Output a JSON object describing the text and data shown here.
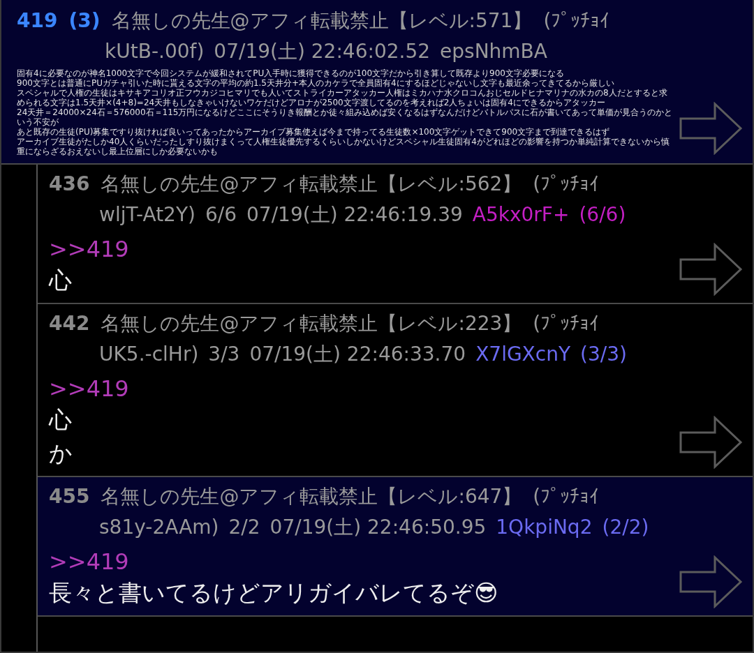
{
  "root_post": {
    "number": "419",
    "reply_count": "(3)",
    "name": "名無しの先生@アフィ転載禁止【レベル:571】",
    "trip": "(ﾌﾟｯﾁｮｲ",
    "id_tail": "kUtB-.00f)",
    "date": "07/19(土) 22:46:02.52",
    "id": "epsNhmBA",
    "highlighted": true,
    "body": [
      "固有4に必要なのが神名1000文字で今回システムが緩和されてPU入手時に獲得できるのが100文字だから引き算して既存より900文字必要になる",
      "900文字とは普通にPUガチャ引いた時に貰える文字の平均の約1.5天井分+本人のカケラで全員固有4にするほどじゃないし文字も最近余ってきてるから厳しい",
      "スペシャルで人権の生徒はキサキアコリオ正フウカジコヒマリでも人いてストライカーアタッカー人権はミカハナ水クロコんおじセルドヒナマリナの水カの8人だとすると求められる文字は1.5天井×(4+8)=24天井もしなきゃいけないワケだけどアロナが2500文字渡してるのを考えれば2人ちょいは固有4にできるからアタッカー",
      "24天井＝24000×24石＝576000石＝115万円になるけどここにそうりき報酬とか徒々組み込めば安くなるはずなんだけどバトルパスに石が書いてあって単価が見合うのかという不安が",
      "あと既存の生徒(PU)募集ですり抜ければ良いってあったからアーカイブ募集使えば今まで持ってる生徒数×100文字ゲットできて900文字まで到達できるはず",
      "アーカイブ生徒がたしか40人くらいだったしすり抜けまくって人権生徒優先するくらいしかないけどスペシャル生徒固有4がどれほどの影響を持つか単純計算できないから慎重にならざるおえないし最上位層にしか必要ないかも"
    ],
    "children": [
      {
        "number": "436",
        "name": "名無しの先生@アフィ転載禁止【レベル:562】",
        "trip": "(ﾌﾟｯﾁｮｲ",
        "id_tail": "wljT-At2Y)",
        "post_count": "6/6",
        "date": "07/19(土) 22:46:19.39",
        "id": "A5kx0rF+",
        "id_count": "(6/6)",
        "color": "#c41fc4",
        "highlighted": false,
        "anchor": ">>419",
        "body": [
          "心"
        ]
      },
      {
        "number": "442",
        "name": "名無しの先生@アフィ転載禁止【レベル:223】",
        "trip": "(ﾌﾟｯﾁｮｲ",
        "id_tail": "UK5.-clHr)",
        "post_count": "3/3",
        "date": "07/19(土) 22:46:33.70",
        "id": "X7lGXcnY",
        "id_count": "(3/3)",
        "color": "#6b6bf2",
        "highlighted": false,
        "anchor": ">>419",
        "body": [
          "心",
          "か"
        ]
      },
      {
        "number": "455",
        "name": "名無しの先生@アフィ転載禁止【レベル:647】",
        "trip": "(ﾌﾟｯﾁｮｲ",
        "id_tail": "s81y-2AAm)",
        "post_count": "2/2",
        "date": "07/19(土) 22:46:50.95",
        "id": "1QkpiNq2",
        "id_count": "(2/2)",
        "color": "#6b6bf2",
        "highlighted": true,
        "anchor": ">>419",
        "body": [
          "長々と書いてるけどアリガイバレてるぞ😎"
        ]
      }
    ]
  }
}
